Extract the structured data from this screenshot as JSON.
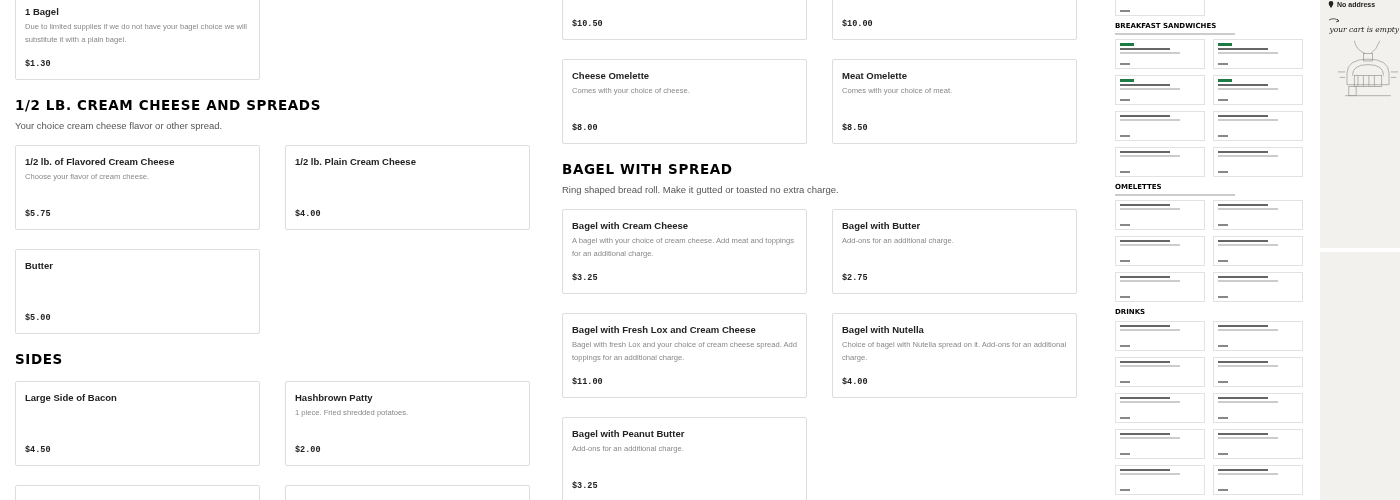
{
  "columns": [
    {
      "sections": [
        {
          "items": [
            {
              "title": "1 Bagel",
              "description": "Due to limited supplies if we do not have your bagel choice we will substitute it with a plain bagel.",
              "price": "$1.30"
            }
          ]
        },
        {
          "heading": "1/2 LB. CREAM CHEESE AND SPREADS",
          "subtitle": "Your choice cream cheese flavor or other spread.",
          "items": [
            {
              "title": "1/2 lb. of Flavored Cream Cheese",
              "description": "Choose your flavor of cream cheese.",
              "price": "$5.75"
            },
            {
              "title": "1/2 lb. Plain Cream Cheese",
              "price": "$4.00"
            },
            {
              "title": "Butter",
              "price": "$5.00"
            }
          ]
        },
        {
          "heading": "SIDES",
          "items": [
            {
              "title": "Large Side of Bacon",
              "price": "$4.50"
            },
            {
              "title": "Hashbrown Patty",
              "description": "1 piece. Fried shredded potatoes.",
              "price": "$2.00"
            },
            {
              "kind": "empty"
            },
            {
              "kind": "empty"
            }
          ]
        }
      ]
    },
    {
      "sections": [
        {
          "items": [
            {
              "price": "$10.50"
            },
            {
              "price": "$10.00"
            },
            {
              "title": "Cheese Omelette",
              "description": "Comes with your choice of cheese.",
              "price": "$8.00"
            },
            {
              "title": "Meat Omelette",
              "description": "Comes with your choice of meat.",
              "price": "$8.50"
            }
          ]
        },
        {
          "heading": "BAGEL WITH SPREAD",
          "subtitle": "Ring shaped bread roll. Make it gutted or toasted no extra charge.",
          "items": [
            {
              "title": "Bagel with Cream Cheese",
              "description": "A bagel with your choice of cream cheese. Add meat and toppings for an additional charge.",
              "price": "$3.25"
            },
            {
              "title": "Bagel with Butter",
              "description": "Add-ons for an additional charge.",
              "price": "$2.75"
            },
            {
              "title": "Bagel with Fresh Lox and Cream Cheese",
              "description": "Bagel with fresh Lox and your choice of cream cheese spread. Add toppings for an additional charge.",
              "price": "$11.00"
            },
            {
              "title": "Bagel with Nutella",
              "description": "Choice of bagel with Nutella spread on it. Add-ons for an additional charge.",
              "price": "$4.00"
            },
            {
              "title": "Bagel with Peanut Butter",
              "description": "Add-ons for an additional charge.",
              "price": "$3.25"
            }
          ]
        }
      ]
    }
  ],
  "preview": {
    "sections": [
      {
        "cards": [
          {
            "badge": false
          }
        ]
      },
      {
        "heading": "BREAKFAST SANDWICHES",
        "note": true,
        "cards": [
          {
            "badge": true
          },
          {
            "badge": true
          },
          {
            "badge": true
          },
          {
            "badge": true
          },
          {
            "badge": false
          },
          {
            "badge": false
          },
          {
            "badge": false
          },
          {
            "badge": false
          }
        ]
      },
      {
        "heading": "OMELETTES",
        "note": true,
        "cards": [
          {
            "badge": false
          },
          {
            "badge": false
          },
          {
            "badge": false
          },
          {
            "badge": false
          },
          {
            "badge": false
          },
          {
            "badge": false
          }
        ]
      },
      {
        "heading": "DRINKS",
        "note": false,
        "cards": [
          {
            "badge": false
          },
          {
            "badge": false
          },
          {
            "badge": false
          },
          {
            "badge": false
          },
          {
            "badge": false
          },
          {
            "badge": false
          },
          {
            "badge": false
          },
          {
            "badge": false
          },
          {
            "badge": false
          },
          {
            "badge": false
          }
        ]
      }
    ]
  },
  "cart": {
    "address": "No address",
    "message": "your cart is empty"
  }
}
